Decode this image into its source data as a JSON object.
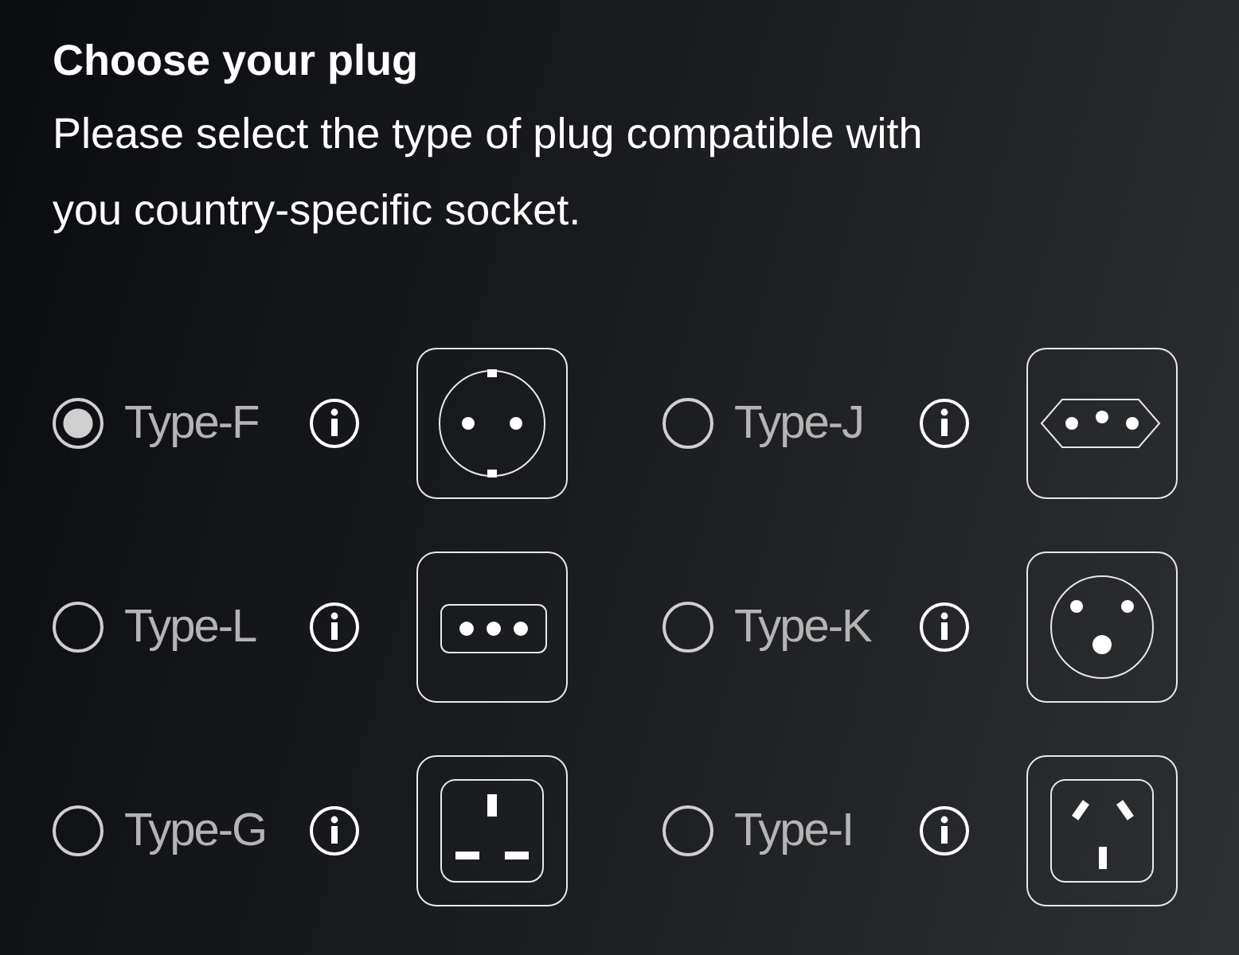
{
  "title": "Choose your plug",
  "description": "Please select the type of plug compatible with you country-specific socket.",
  "plugs": [
    {
      "label": "Type-F",
      "kind": "schuko",
      "selected": true
    },
    {
      "label": "Type-J",
      "kind": "swiss",
      "selected": false
    },
    {
      "label": "Type-L",
      "kind": "italian",
      "selected": false
    },
    {
      "label": "Type-K",
      "kind": "danish",
      "selected": false
    },
    {
      "label": "Type-G",
      "kind": "british",
      "selected": false
    },
    {
      "label": "Type-I",
      "kind": "australian",
      "selected": false
    }
  ]
}
